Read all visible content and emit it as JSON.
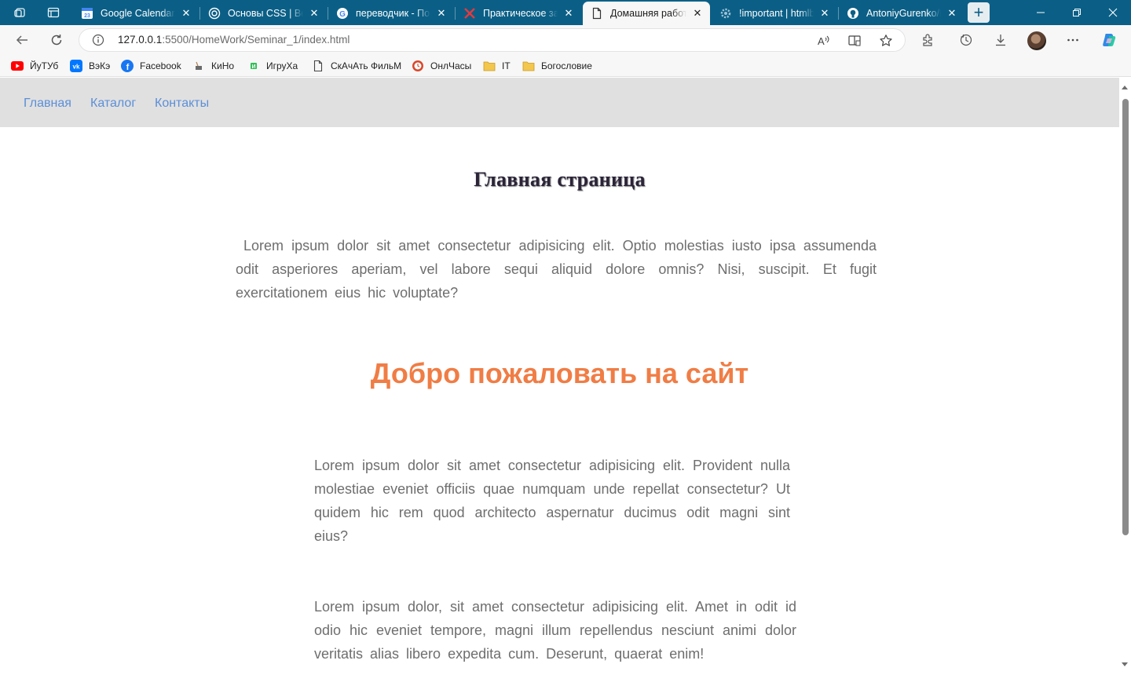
{
  "browser": {
    "tabs": [
      {
        "title": "Google Calendar - ",
        "favicon": "google-calendar-icon",
        "active": false
      },
      {
        "title": "Основы CSS | Веб",
        "favicon": "chatgpt-icon",
        "active": false
      },
      {
        "title": "переводчик - Пои",
        "favicon": "google-icon",
        "active": false
      },
      {
        "title": "Практическое зад",
        "favicon": "red-cross-icon",
        "active": false
      },
      {
        "title": "Домашняя работа",
        "favicon": "document-icon",
        "active": true
      },
      {
        "title": "!important | htmlb",
        "favicon": "gear-icon",
        "active": false
      },
      {
        "title": "AntoniyGurenko/H",
        "favicon": "github-icon",
        "active": false
      }
    ],
    "new_tab_label": "+",
    "address": {
      "host": "127.0.0.1",
      "path": ":5500/HomeWork/Seminar_1/index.html"
    },
    "bookmarks": [
      {
        "label": "ЙуТУб",
        "icon": "youtube-icon"
      },
      {
        "label": "ВэКэ",
        "icon": "vk-icon"
      },
      {
        "label": "Facebook",
        "icon": "facebook-icon"
      },
      {
        "label": "КиНо",
        "icon": "film-icon"
      },
      {
        "label": "ИгруХа",
        "icon": "game-icon"
      },
      {
        "label": "СкАчАть ФильМ",
        "icon": "page-icon"
      },
      {
        "label": "ОнлЧасы",
        "icon": "clock-icon"
      },
      {
        "label": "IT",
        "icon": "folder-icon"
      },
      {
        "label": "Богословие",
        "icon": "folder-icon"
      }
    ]
  },
  "page": {
    "nav": [
      "Главная",
      "Каталог",
      "Контакты"
    ],
    "title": "Главная страница",
    "paragraph1": "Lorem ipsum dolor sit amet consectetur adipisicing elit. Optio molestias iusto ipsa assumenda odit asperiores aperiam, vel labore sequi aliquid dolore omnis? Nisi, suscipit. Et fugit exercitationem eius hic voluptate?",
    "welcome": "Добро пожаловать на сайт",
    "paragraph2": "Lorem ipsum dolor sit amet consectetur adipisicing elit. Provident nulla molestiae eveniet officiis quae numquam unde repellat consectetur? Ut quidem hic rem quod architecto aspernatur ducimus odit magni sint eius?",
    "paragraph3": "Lorem ipsum dolor, sit amet consectetur adipisicing elit. Amet in odit id odio hic eveniet tempore, magni illum repellendus nesciunt animi dolor veritatis alias libero expedita cum. Deserunt, quaerat enim!"
  },
  "colors": {
    "tabstrip": "#0b5f86",
    "nav_link": "#5b8fd8",
    "welcome": "#f07d45",
    "body_text": "#6e6e6e"
  }
}
